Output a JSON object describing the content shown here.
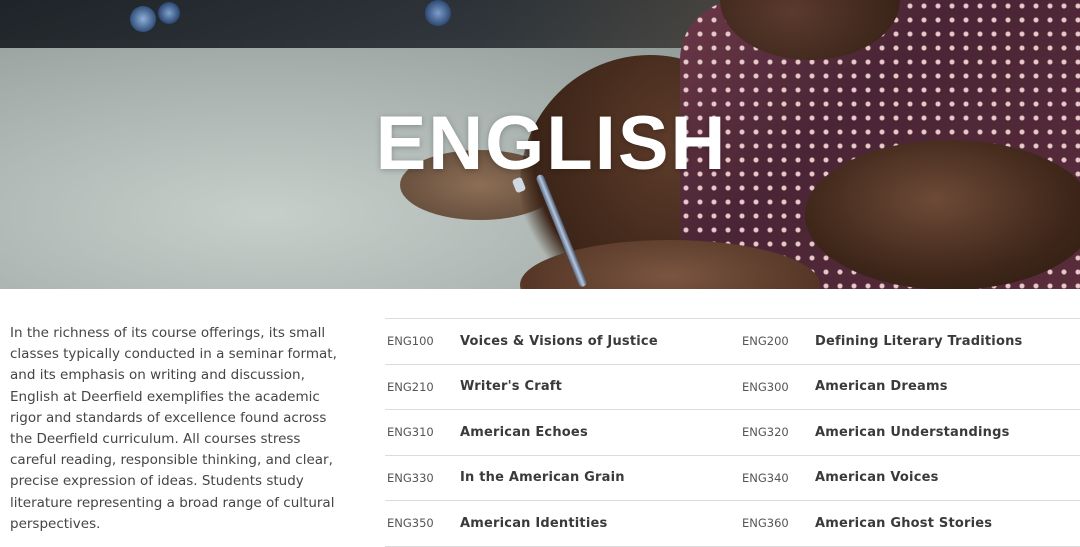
{
  "hero": {
    "title": "ENGLISH"
  },
  "intro": {
    "text": "In the richness of its course offerings, its small classes typically conducted in a seminar format, and its emphasis on writing and discussion, English at Deerfield exemplifies the academic rigor and standards of excellence found across the Deerfield curriculum. All courses stress careful reading, responsible thinking, and clear, precise expression of ideas. Students study literature representing a broad range of cultural perspectives."
  },
  "courses": [
    [
      {
        "code": "ENG100",
        "title": "Voices & Visions of Justice"
      },
      {
        "code": "ENG200",
        "title": "Defining Literary Traditions"
      }
    ],
    [
      {
        "code": "ENG210",
        "title": "Writer's Craft"
      },
      {
        "code": "ENG300",
        "title": "American Dreams"
      }
    ],
    [
      {
        "code": "ENG310",
        "title": "American Echoes"
      },
      {
        "code": "ENG320",
        "title": "American Understandings"
      }
    ],
    [
      {
        "code": "ENG330",
        "title": "In the American Grain"
      },
      {
        "code": "ENG340",
        "title": "American Voices"
      }
    ],
    [
      {
        "code": "ENG350",
        "title": "American Identities"
      },
      {
        "code": "ENG360",
        "title": "American Ghost Stories"
      }
    ]
  ]
}
